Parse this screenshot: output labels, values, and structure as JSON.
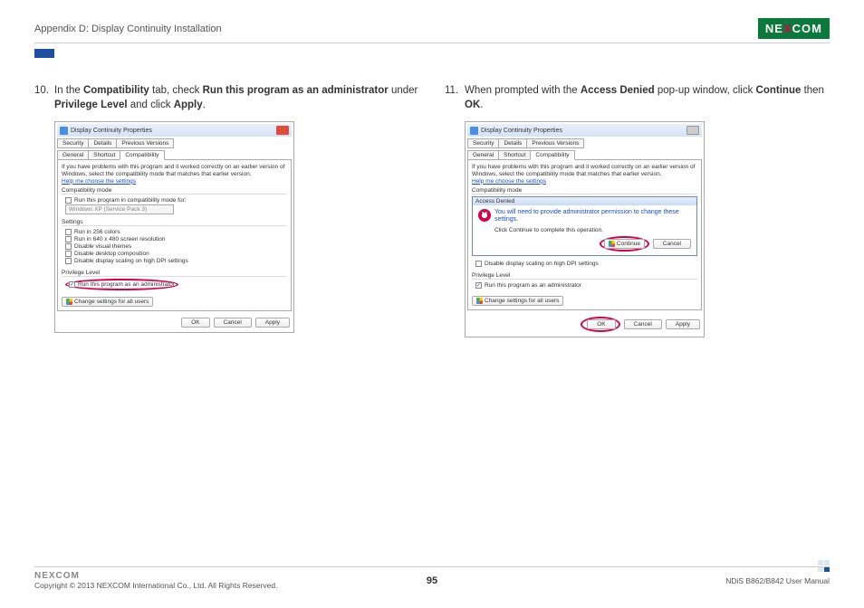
{
  "header": {
    "appendix": "Appendix D: Display Continuity Installation",
    "logo_pre": "NE",
    "logo_x": "X",
    "logo_post": "COM"
  },
  "left": {
    "num": "10.",
    "text_parts": [
      "In the ",
      "Compatibility",
      " tab, check ",
      "Run this program as an administrator",
      " under ",
      "Privilege Level",
      " and click ",
      "Apply",
      "."
    ],
    "dlg": {
      "title": "Display Continuity Properties",
      "tabs_row1": [
        "Security",
        "Details",
        "Previous Versions"
      ],
      "tabs_row2": [
        "General",
        "Shortcut",
        "Compatibility"
      ],
      "desc": "If you have problems with this program and it worked correctly on an earlier version of Windows, select the compatibility mode that matches that earlier version.",
      "link": "Help me choose the settings",
      "compat_label": "Compatibility mode",
      "compat_cb": "Run this program in compatibility mode for:",
      "compat_sel": "Windows XP (Service Pack 3)",
      "settings_label": "Settings",
      "settings_items": [
        "Run in 256 colors",
        "Run in 640 x 480 screen resolution",
        "Disable visual themes",
        "Disable desktop composition",
        "Disable display scaling on high DPI settings"
      ],
      "priv_label": "Privilege Level",
      "priv_cb": "Run this program as an administrator",
      "change_btn": "Change settings for all users",
      "ok": "OK",
      "cancel": "Cancel",
      "apply": "Apply"
    }
  },
  "right": {
    "num": "11.",
    "text_parts": [
      "When prompted with the ",
      "Access Denied",
      " pop-up window, click ",
      "Continue",
      " then ",
      "OK",
      "."
    ],
    "dlg": {
      "title": "Display Continuity Properties",
      "popup_title": "Access Denied",
      "popup_msg": "You will need to provide administrator permission to change these settings.",
      "popup_sub": "Click Continue to complete this operation.",
      "continue": "Continue",
      "cancel": "Cancel",
      "dpi_cb": "Disable display scaling on high DPI settings",
      "priv_label": "Privilege Level",
      "priv_cb": "Run this program as an administrator",
      "change_btn": "Change settings for all users",
      "ok": "OK",
      "cancel2": "Cancel",
      "apply": "Apply"
    }
  },
  "footer": {
    "copyright": "Copyright © 2013 NEXCOM International Co., Ltd. All Rights Reserved.",
    "page": "95",
    "manual": "NDiS B862/B842 User Manual",
    "logo": "NEXCOM"
  }
}
